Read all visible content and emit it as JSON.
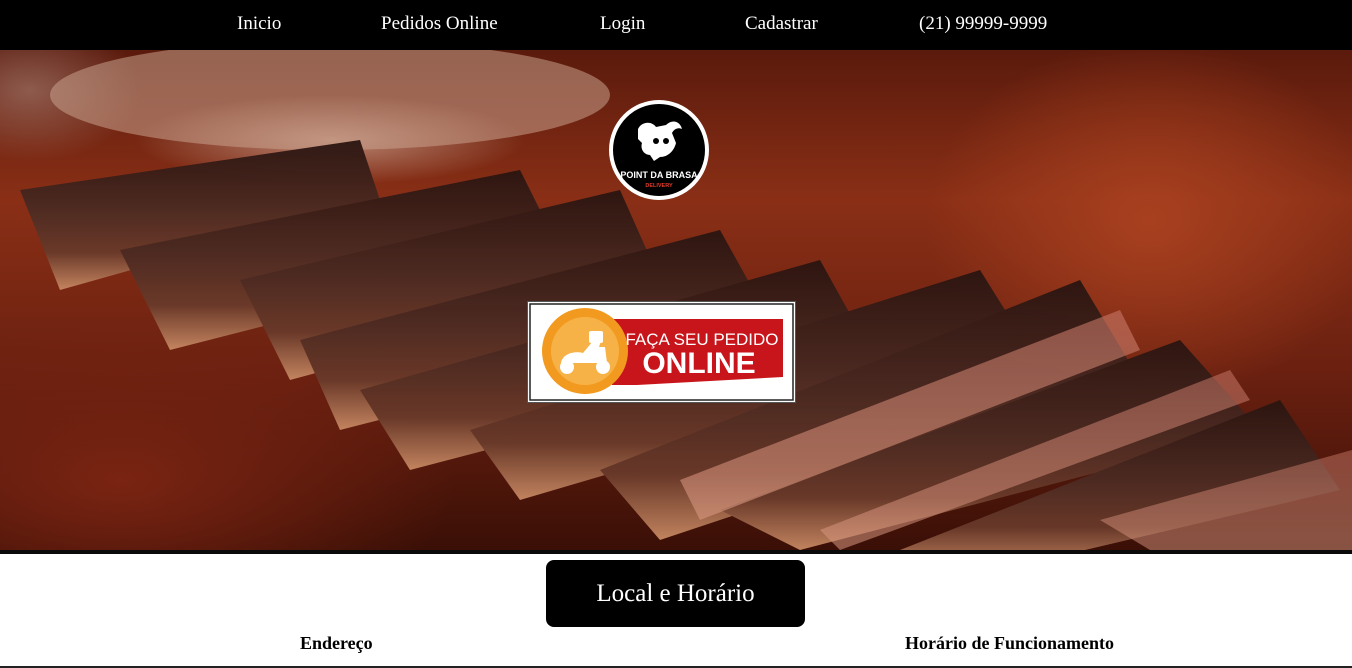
{
  "nav": {
    "items": [
      {
        "label": "Inicio"
      },
      {
        "label": "Pedidos Online"
      },
      {
        "label": "Login"
      },
      {
        "label": "Cadastrar"
      },
      {
        "label": "(21) 99999-9999"
      }
    ]
  },
  "hero": {
    "image": "grilled-steak-slices-on-board",
    "logo": {
      "text_line1": "POINT DA BRASA",
      "text_line2": "DELIVERY",
      "icon": "bull-icon"
    },
    "order_banner": {
      "line1": "FAÇA SEU PEDIDO",
      "line2": "ONLINE",
      "icon": "scooter-icon"
    }
  },
  "info": {
    "button_label": "Local e Horário",
    "address_heading": "Endereço",
    "hours_heading": "Horário de Funcionamento"
  },
  "colors": {
    "nav_bg": "#000000",
    "banner_red": "#c8151b",
    "banner_orange": "#f29a1f"
  }
}
